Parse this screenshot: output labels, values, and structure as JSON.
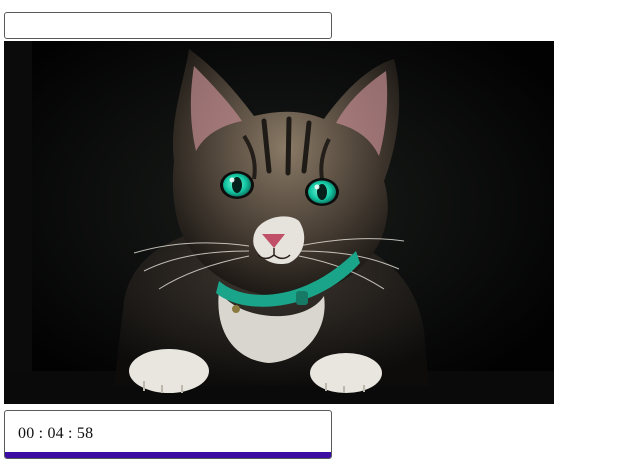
{
  "top_field": {
    "value": ""
  },
  "photo": {
    "subject": "cat-photo"
  },
  "timer": {
    "display": "00 : 04 : 58",
    "progress_fraction": 1.0,
    "bar_color": "#3a0ca3"
  }
}
